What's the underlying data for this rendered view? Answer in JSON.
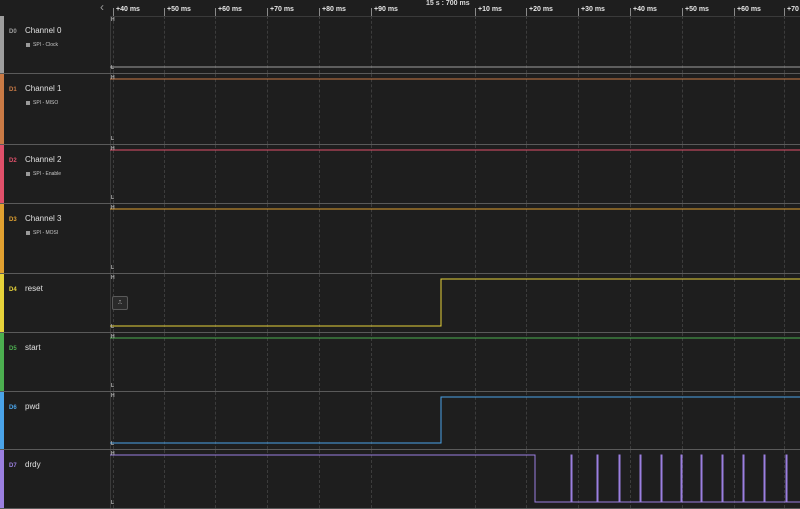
{
  "ruler": {
    "center_time": "15 s : 700 ms",
    "ticks": [
      "+40 ms",
      "+50 ms",
      "+60 ms",
      "+70 ms",
      "+80 ms",
      "+90 ms",
      "+10 ms",
      "+20 ms",
      "+30 ms",
      "+40 ms",
      "+50 ms",
      "+60 ms",
      "+70 ms"
    ]
  },
  "level_labels": {
    "high": "H",
    "low": "L"
  },
  "channels": [
    {
      "dnum": "D0",
      "name": "Channel 0",
      "analyzer": "SPI - Clock",
      "color": "#9e9e9e"
    },
    {
      "dnum": "D1",
      "name": "Channel 1",
      "analyzer": "SPI - MISO",
      "color": "#c97a45"
    },
    {
      "dnum": "D2",
      "name": "Channel 2",
      "analyzer": "SPI - Enable",
      "color": "#e0506a"
    },
    {
      "dnum": "D3",
      "name": "Channel 3",
      "analyzer": "SPI - MOSI",
      "color": "#e0a030"
    },
    {
      "dnum": "D4",
      "name": "reset",
      "analyzer": "",
      "color": "#e6d23a"
    },
    {
      "dnum": "D5",
      "name": "start",
      "analyzer": "",
      "color": "#4caf50"
    },
    {
      "dnum": "D6",
      "name": "pwd",
      "analyzer": "",
      "color": "#4aa3e8"
    },
    {
      "dnum": "D7",
      "name": "drdy",
      "analyzer": "",
      "color": "#9b7fe0"
    }
  ],
  "signals": {
    "D0": {
      "description": "constant low"
    },
    "D1": {
      "description": "constant high"
    },
    "D2": {
      "description": "constant high"
    },
    "D3": {
      "description": "constant high"
    },
    "D4": {
      "description": "low then rising edge to high"
    },
    "D5": {
      "description": "constant high"
    },
    "D6": {
      "description": "low then rising edge to high"
    },
    "D7": {
      "description": "high then low with periodic short pulses"
    }
  },
  "icons": {
    "collapse": "chevron-left-icon",
    "measure": "measure-icon"
  }
}
